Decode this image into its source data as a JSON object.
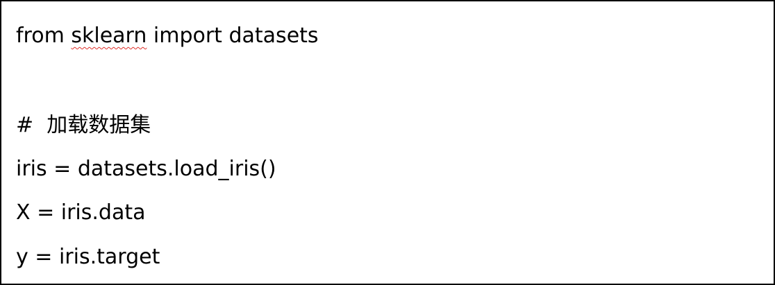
{
  "document": {
    "lines": [
      {
        "before": "from ",
        "flagged": "sklearn",
        "after": " import datasets"
      },
      {
        "text": "#  加载数据集"
      },
      {
        "text": "iris = datasets.load_iris()"
      },
      {
        "text": "X = iris.data"
      },
      {
        "text": "y = iris.target"
      }
    ]
  },
  "colors": {
    "border": "#000000",
    "text": "#000000",
    "spell_underline": "#e0302a"
  }
}
